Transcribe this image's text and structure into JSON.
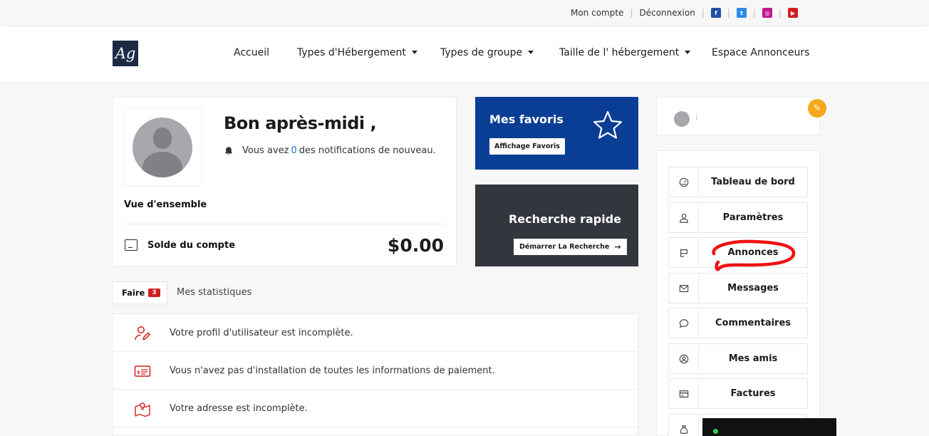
{
  "topbar": {
    "account": "Mon compte",
    "logout": "Déconnexion",
    "socials": [
      {
        "icon": "facebook-icon",
        "color": "#1f4fa3",
        "glyph": "f"
      },
      {
        "icon": "twitter-icon",
        "color": "#2d8ae6",
        "glyph": "t"
      },
      {
        "icon": "instagram-icon",
        "color": "#c2188f",
        "glyph": "◎"
      },
      {
        "icon": "youtube-icon",
        "color": "#d31d1d",
        "glyph": "▶"
      }
    ]
  },
  "nav": {
    "logo": "Ag",
    "items": [
      {
        "label": "Accueil",
        "dropdown": false
      },
      {
        "label": "Types d'Hébergement",
        "dropdown": true
      },
      {
        "label": "Types de groupe",
        "dropdown": true
      },
      {
        "label": "Taille de l' hébergement",
        "dropdown": true
      },
      {
        "label": "Espace Annonceurs",
        "dropdown": false
      }
    ]
  },
  "profile": {
    "greeting": "Bon après-midi ,",
    "notif_prefix": "Vous avez",
    "notif_count": "0",
    "notif_suffix": "des notifications de nouveau.",
    "overview_label": "Vue d'ensemble",
    "balance_label": "Solde du compte",
    "balance_value": "$0.00"
  },
  "favorites": {
    "title": "Mes favoris",
    "button": "Affichage Favoris"
  },
  "quick_search": {
    "title": "Recherche rapide",
    "button": "Démarrer La Recherche"
  },
  "tabs": {
    "todo_label": "Faire",
    "todo_count": "3",
    "stats_label": "Mes statistiques"
  },
  "todos": [
    {
      "icon": "user-edit-icon",
      "text": "Votre profil d'utilisateur est incomplète."
    },
    {
      "icon": "payment-card-icon",
      "text": "Vous n'avez pas d'installation de toutes les informations de paiement."
    },
    {
      "icon": "map-location-icon",
      "text": "Votre adresse est incomplète."
    }
  ],
  "user_card": {
    "name": "I"
  },
  "menu": [
    {
      "icon": "dashboard-icon",
      "label": "Tableau de bord"
    },
    {
      "icon": "user-icon",
      "label": "Paramètres"
    },
    {
      "icon": "flag-icon",
      "label": "Annonces"
    },
    {
      "icon": "envelope-icon",
      "label": "Messages"
    },
    {
      "icon": "comment-icon",
      "label": "Commentaires"
    },
    {
      "icon": "friends-icon",
      "label": "Mes amis"
    },
    {
      "icon": "invoice-icon",
      "label": "Factures"
    },
    {
      "icon": "bag-icon",
      "label": ""
    }
  ],
  "colors": {
    "brand_blue": "#0a3e95",
    "dark_panel": "#32373d",
    "accent_red": "#d31d1d",
    "edit_orange": "#f5a81b",
    "annotation_red": "#ee1111"
  }
}
